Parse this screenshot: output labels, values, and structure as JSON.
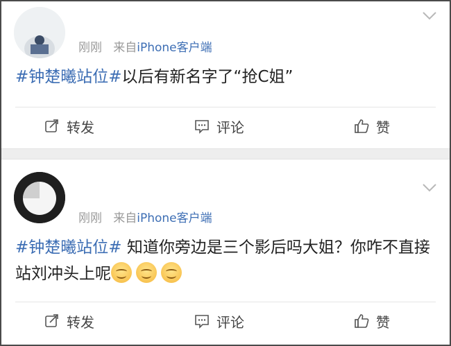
{
  "posts": [
    {
      "time": "刚刚",
      "source_prefix": "来自",
      "source": "iPhone客户端",
      "hashtag": "#钟楚曦站位#",
      "text": "以后有新名字了“抢C姐”",
      "emoji_count": 0,
      "actions": {
        "repost": "转发",
        "comment": "评论",
        "like": "赞"
      }
    },
    {
      "time": "刚刚",
      "source_prefix": "来自",
      "source": "iPhone客户端",
      "hashtag": "#钟楚曦站位#",
      "text": " 知道你旁边是三个影后吗大姐？你咋不直接站刘冲头上呢",
      "emoji_count": 3,
      "actions": {
        "repost": "转发",
        "comment": "评论",
        "like": "赞"
      }
    }
  ],
  "colors": {
    "link": "#3d6eb4",
    "meta": "#9a9a9a",
    "text": "#222222",
    "separator": "#eeeeee"
  }
}
